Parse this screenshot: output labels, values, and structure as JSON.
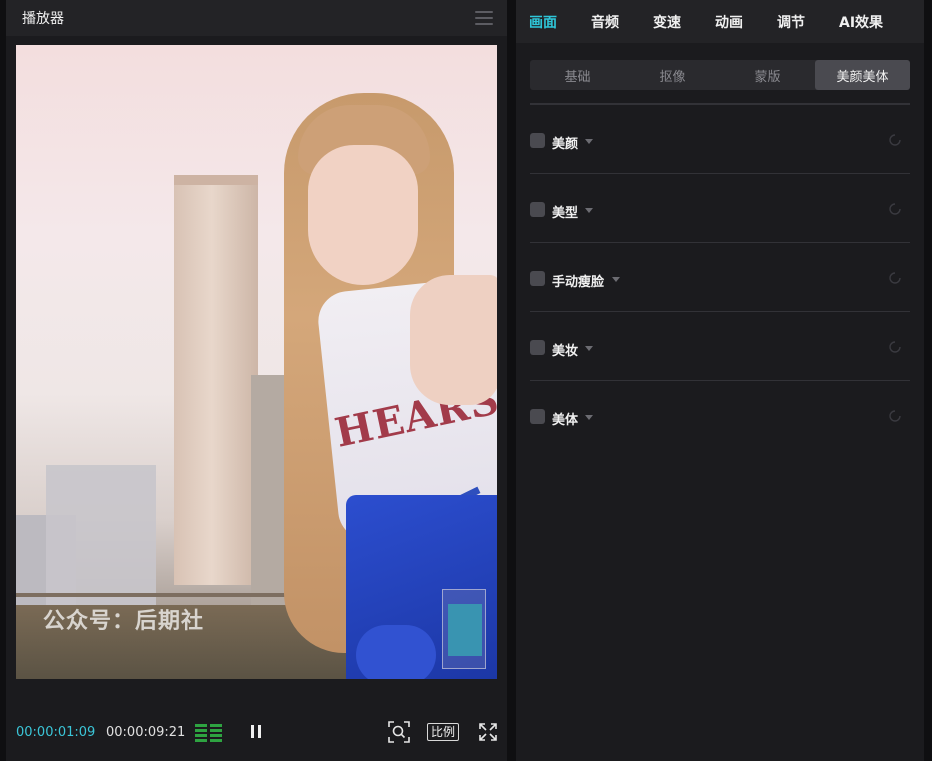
{
  "player": {
    "title": "播放器",
    "watermark": "公众号：后期社",
    "jersey_text": "HEARS",
    "timecode_current": "00:00:01:09",
    "timecode_total": "00:00:09:21",
    "ratio_label": "比例"
  },
  "properties": {
    "tabs": [
      {
        "label": "画面",
        "active": true
      },
      {
        "label": "音频"
      },
      {
        "label": "变速"
      },
      {
        "label": "动画"
      },
      {
        "label": "调节"
      },
      {
        "label": "AI效果"
      }
    ],
    "subtabs": [
      {
        "label": "基础"
      },
      {
        "label": "抠像"
      },
      {
        "label": "蒙版"
      },
      {
        "label": "美颜美体",
        "active": true
      }
    ],
    "sections": [
      {
        "label": "美颜",
        "checked": false
      },
      {
        "label": "美型",
        "checked": false
      },
      {
        "label": "手动瘦脸",
        "checked": false
      },
      {
        "label": "美妆",
        "checked": false
      },
      {
        "label": "美体",
        "checked": false
      }
    ]
  },
  "colors": {
    "accent": "#2ec7d9",
    "panel_bg": "#1b1b1e",
    "header_bg": "#232326",
    "level_meter": "#2ea341"
  }
}
